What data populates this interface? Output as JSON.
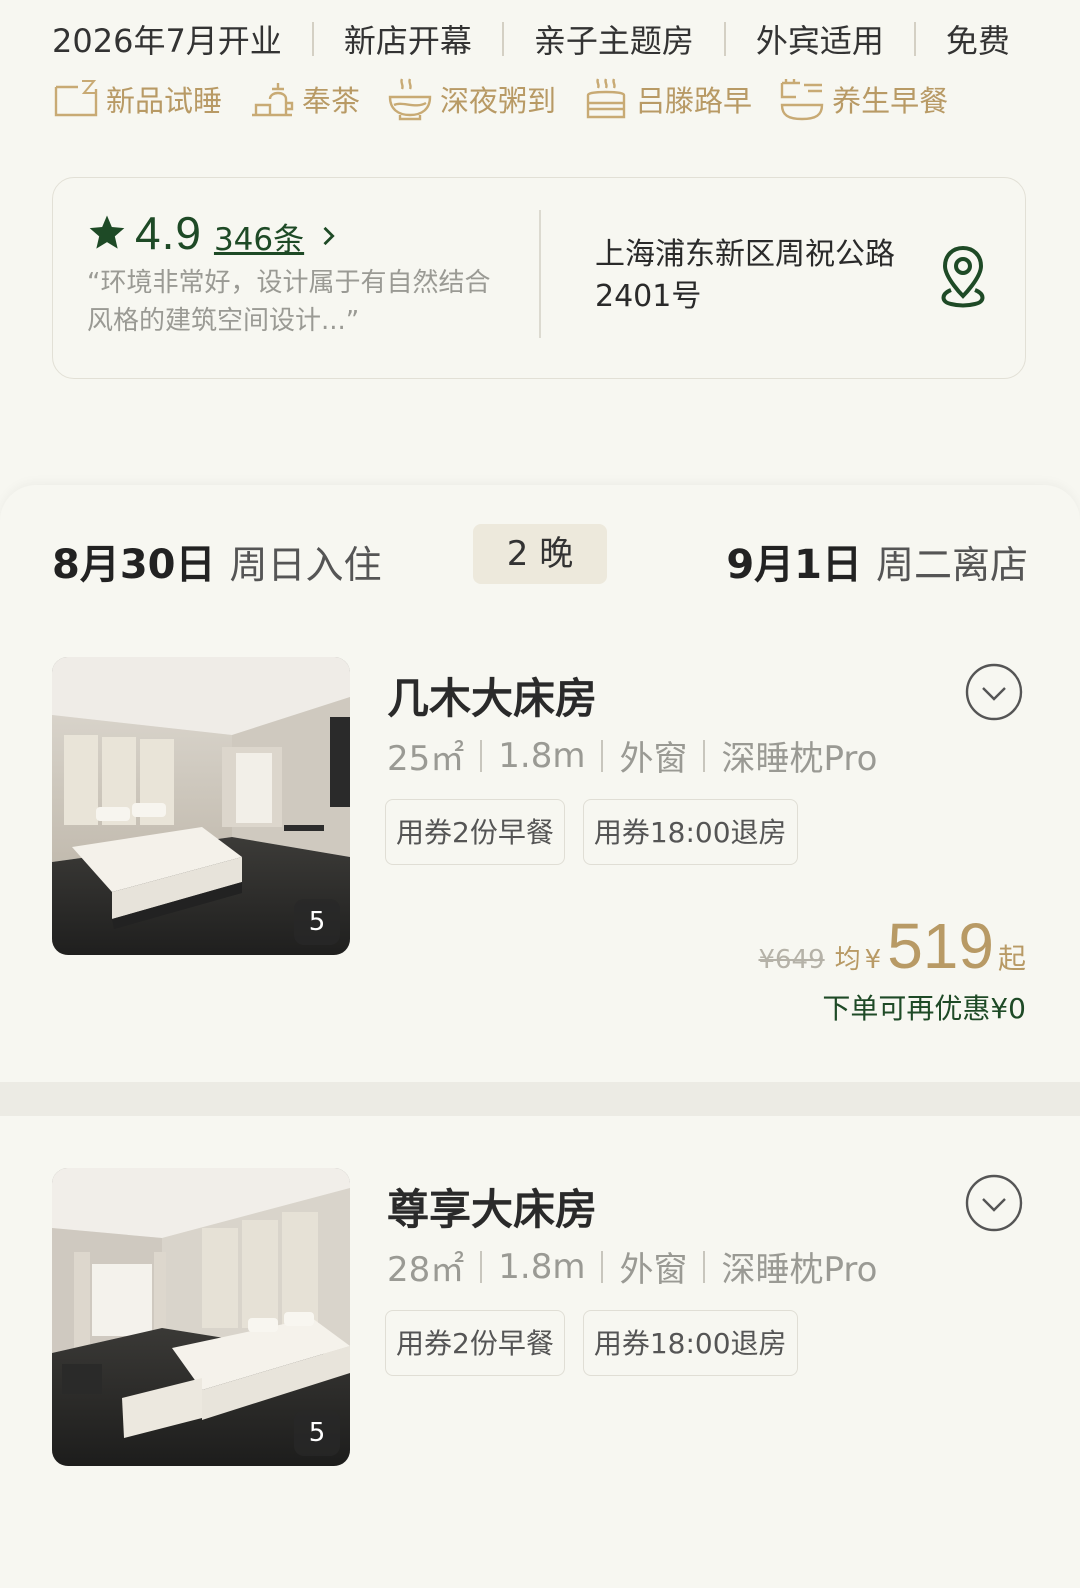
{
  "top_tags": [
    "2026年7月开业",
    "新店开幕",
    "亲子主题房",
    "外宾适用",
    "免费"
  ],
  "amenities": [
    {
      "icon": "bed-trial-icon",
      "label": "新品试睡"
    },
    {
      "icon": "tea-icon",
      "label": "奉茶"
    },
    {
      "icon": "congee-bowl-icon",
      "label": "深夜粥到"
    },
    {
      "icon": "steamer-icon",
      "label": "吕滕路早"
    },
    {
      "icon": "breakfast-icon",
      "label": "养生早餐"
    }
  ],
  "hotel_info": {
    "rating": "4.9",
    "review_count": "346条",
    "review_quote": "“环境非常好，设计属于有自然结合风格的建筑空间设计...”",
    "address": "上海浦东新区周祝公路2401号"
  },
  "stay": {
    "checkin_date": "8月30日",
    "checkin_label": "周日入住",
    "nights": "2 晚",
    "checkout_date": "9月1日",
    "checkout_label": "周二离店"
  },
  "rooms": [
    {
      "name": "几木大床房",
      "specs": [
        "25㎡",
        "1.8m",
        "外窗",
        "深睡枕Pro"
      ],
      "perks": [
        "用券2份早餐",
        "用券18:00退房"
      ],
      "photo_count": "5",
      "original_price": "¥649",
      "avg_label": "均",
      "currency": "¥",
      "price": "519",
      "price_suffix": "起",
      "discount_note": "下单可再优惠¥0"
    },
    {
      "name": "尊享大床房",
      "specs": [
        "28㎡",
        "1.8m",
        "外窗",
        "深睡枕Pro"
      ],
      "perks": [
        "用券2份早餐",
        "用券18:00退房"
      ],
      "photo_count": "5"
    }
  ],
  "colors": {
    "accent_gold": "#b89a65",
    "brand_green": "#1e4a26",
    "background": "#f7f7f1"
  }
}
